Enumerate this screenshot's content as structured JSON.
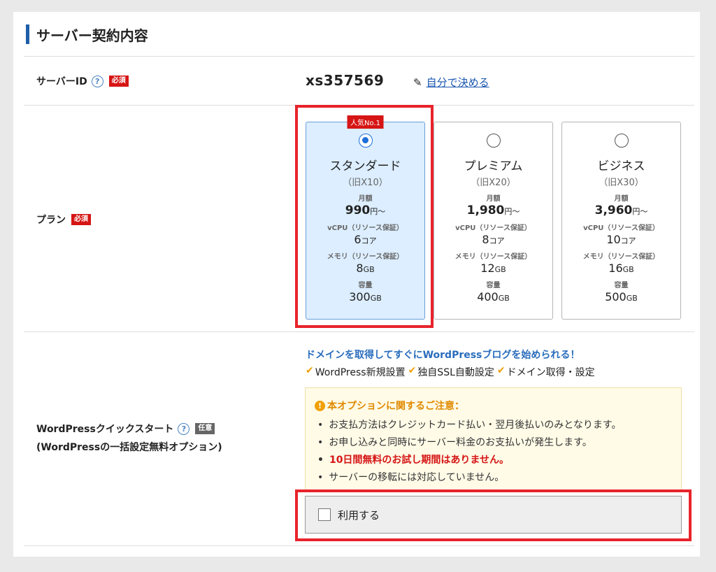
{
  "section": {
    "title": "サーバー契約内容"
  },
  "server_id": {
    "label": "サーバーID",
    "help": "?",
    "required_badge": "必須",
    "value": "xs357569",
    "self_decide_link": "自分で決める",
    "icon": "pencil-icon"
  },
  "plan": {
    "label": "プラン",
    "required_badge": "必須",
    "popular_badge": "人気No.1",
    "spec_labels": {
      "monthly": "月額",
      "vcpu": "vCPU（リソース保証）",
      "memory": "メモリ（リソース保証）",
      "storage": "容量"
    },
    "price_suffix": "円～",
    "cpu_unit": "コア",
    "gb_unit": "GB",
    "options": [
      {
        "name": "スタンダード",
        "old": "（旧X10）",
        "price": "990",
        "vcpu": "6",
        "memory": "8",
        "storage": "300",
        "selected": true
      },
      {
        "name": "プレミアム",
        "old": "（旧X20）",
        "price": "1,980",
        "vcpu": "8",
        "memory": "12",
        "storage": "400",
        "selected": false
      },
      {
        "name": "ビジネス",
        "old": "（旧X30）",
        "price": "3,960",
        "vcpu": "10",
        "memory": "16",
        "storage": "500",
        "selected": false
      }
    ]
  },
  "wp_quick": {
    "label_line1": "WordPressクイックスタート",
    "label_line2": "(WordPressの一括設定無料オプション)",
    "help": "?",
    "optional_badge": "任意",
    "headline": "ドメインを取得してすぐにWordPressブログを始められる！",
    "features": [
      "WordPress新規設置",
      "独自SSL自動設定",
      "ドメイン取得・設定"
    ],
    "check_mark": "✔",
    "notice_icon": "!",
    "notice_title": "本オプションに関するご注意：",
    "notices": [
      "お支払方法はクレジットカード払い・翌月後払いのみとなります。",
      "お申し込みと同時にサーバー料金のお支払いが発生します。",
      "10日間無料のお試し期間はありません。",
      "サーバーの移転には対応していません。"
    ],
    "use_label": "利用する",
    "use_checked": false
  },
  "colors": {
    "accent_blue": "#1f5fa8",
    "required_red": "#d61515",
    "highlight_frame": "#e8232b",
    "selected_bg": "#dceeff",
    "notice_bg": "#fffbe7",
    "warning_orange": "#e08a00"
  }
}
